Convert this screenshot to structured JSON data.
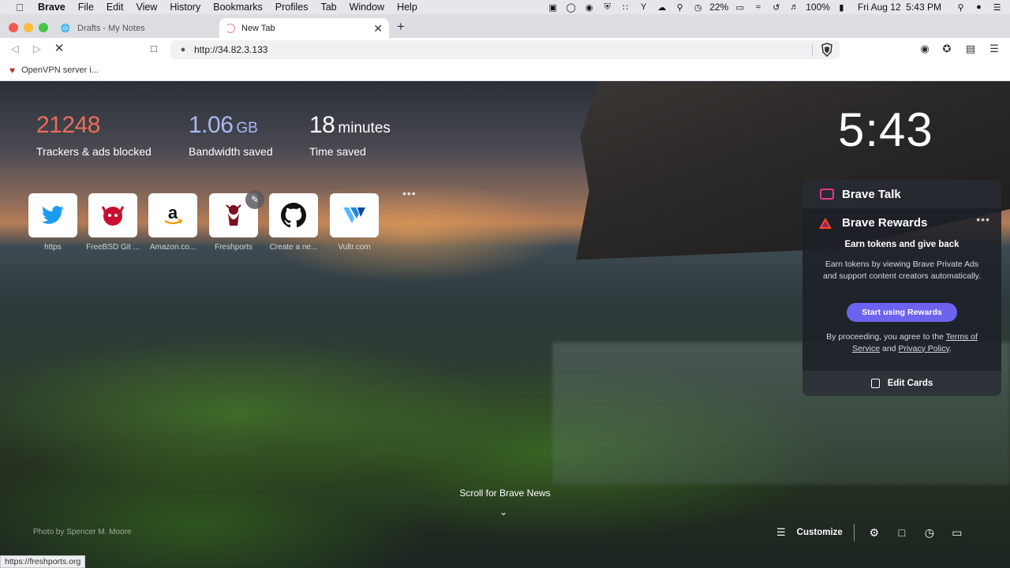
{
  "menubar": {
    "app_name": "Brave",
    "items": [
      "File",
      "Edit",
      "View",
      "History",
      "Bookmarks",
      "Profiles",
      "Tab",
      "Window",
      "Help"
    ],
    "battery_small": "22%",
    "battery": "100%",
    "datetime": "Fri Aug 12  5:43 PM"
  },
  "tabs": [
    {
      "title": "Drafts - My Notes",
      "icon": "globe-icon"
    },
    {
      "title": "New Tab",
      "icon": "loading-icon"
    }
  ],
  "toolbar": {
    "url": "http://34.82.3.133"
  },
  "bookmarks": [
    {
      "label": "OpenVPN server i...",
      "icon": "daemon-icon"
    }
  ],
  "stats": {
    "trackers_value": "21248",
    "trackers_label": "Trackers & ads blocked",
    "bandwidth_value": "1.06",
    "bandwidth_unit": "GB",
    "bandwidth_label": "Bandwidth saved",
    "time_value": "18",
    "time_unit": "minutes",
    "time_label": "Time saved"
  },
  "clock": "5:43",
  "top_sites": [
    {
      "label": "https",
      "icon": "twitter-icon"
    },
    {
      "label": "FreeBSD Git ...",
      "icon": "freebsd-icon"
    },
    {
      "label": "Amazon.co...",
      "icon": "amazon-icon"
    },
    {
      "label": "Freshports",
      "icon": "freshports-icon"
    },
    {
      "label": "Create a ne...",
      "icon": "github-icon"
    },
    {
      "label": "Vultr.com",
      "icon": "vultr-icon"
    }
  ],
  "widgets": {
    "talk_title": "Brave Talk",
    "rewards_title": "Brave Rewards",
    "rewards_subtitle": "Earn tokens and give back",
    "rewards_desc": "Earn tokens by viewing Brave Private Ads and support content creators automatically.",
    "rewards_button": "Start using Rewards",
    "legal_prefix": "By proceeding, you agree to the",
    "terms_link": "Terms of Service",
    "legal_and": "and",
    "privacy_link": "Privacy Policy",
    "edit_cards": "Edit Cards"
  },
  "bottom": {
    "scroll_news": "Scroll for Brave News",
    "photo_credit": "Photo by Spencer M. Moore",
    "customize": "Customize"
  },
  "status_url": "https://freshports.org",
  "colors": {
    "trackers": "#ef6a5a",
    "bandwidth": "#a9b9f2",
    "rewards_button": "#6c63ef",
    "talk_icon": "#e63a8c"
  }
}
